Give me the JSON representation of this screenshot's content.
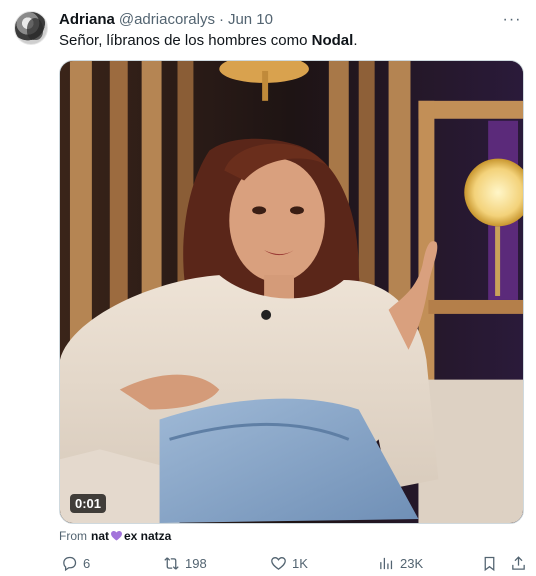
{
  "tweet": {
    "author_name": "Adriana",
    "author_handle": "@adriacoralys",
    "separator": "·",
    "date": "Jun 10",
    "more_label": "···",
    "text_plain": "Señor, líbranos de los hombres como ",
    "text_bold": "Nodal",
    "text_end": "."
  },
  "media": {
    "timestamp": "0:01"
  },
  "source": {
    "prefix": "From",
    "name_part1": "nat",
    "name_part2": "ex natza",
    "heart_color": "#a374db"
  },
  "actions": {
    "replies": "6",
    "reposts": "198",
    "likes": "1K",
    "views": "23K"
  },
  "icons": [
    "avatar",
    "more-icon",
    "reply-icon",
    "repost-icon",
    "like-icon",
    "views-icon",
    "bookmark-icon",
    "share-icon",
    "purple-heart-icon"
  ]
}
